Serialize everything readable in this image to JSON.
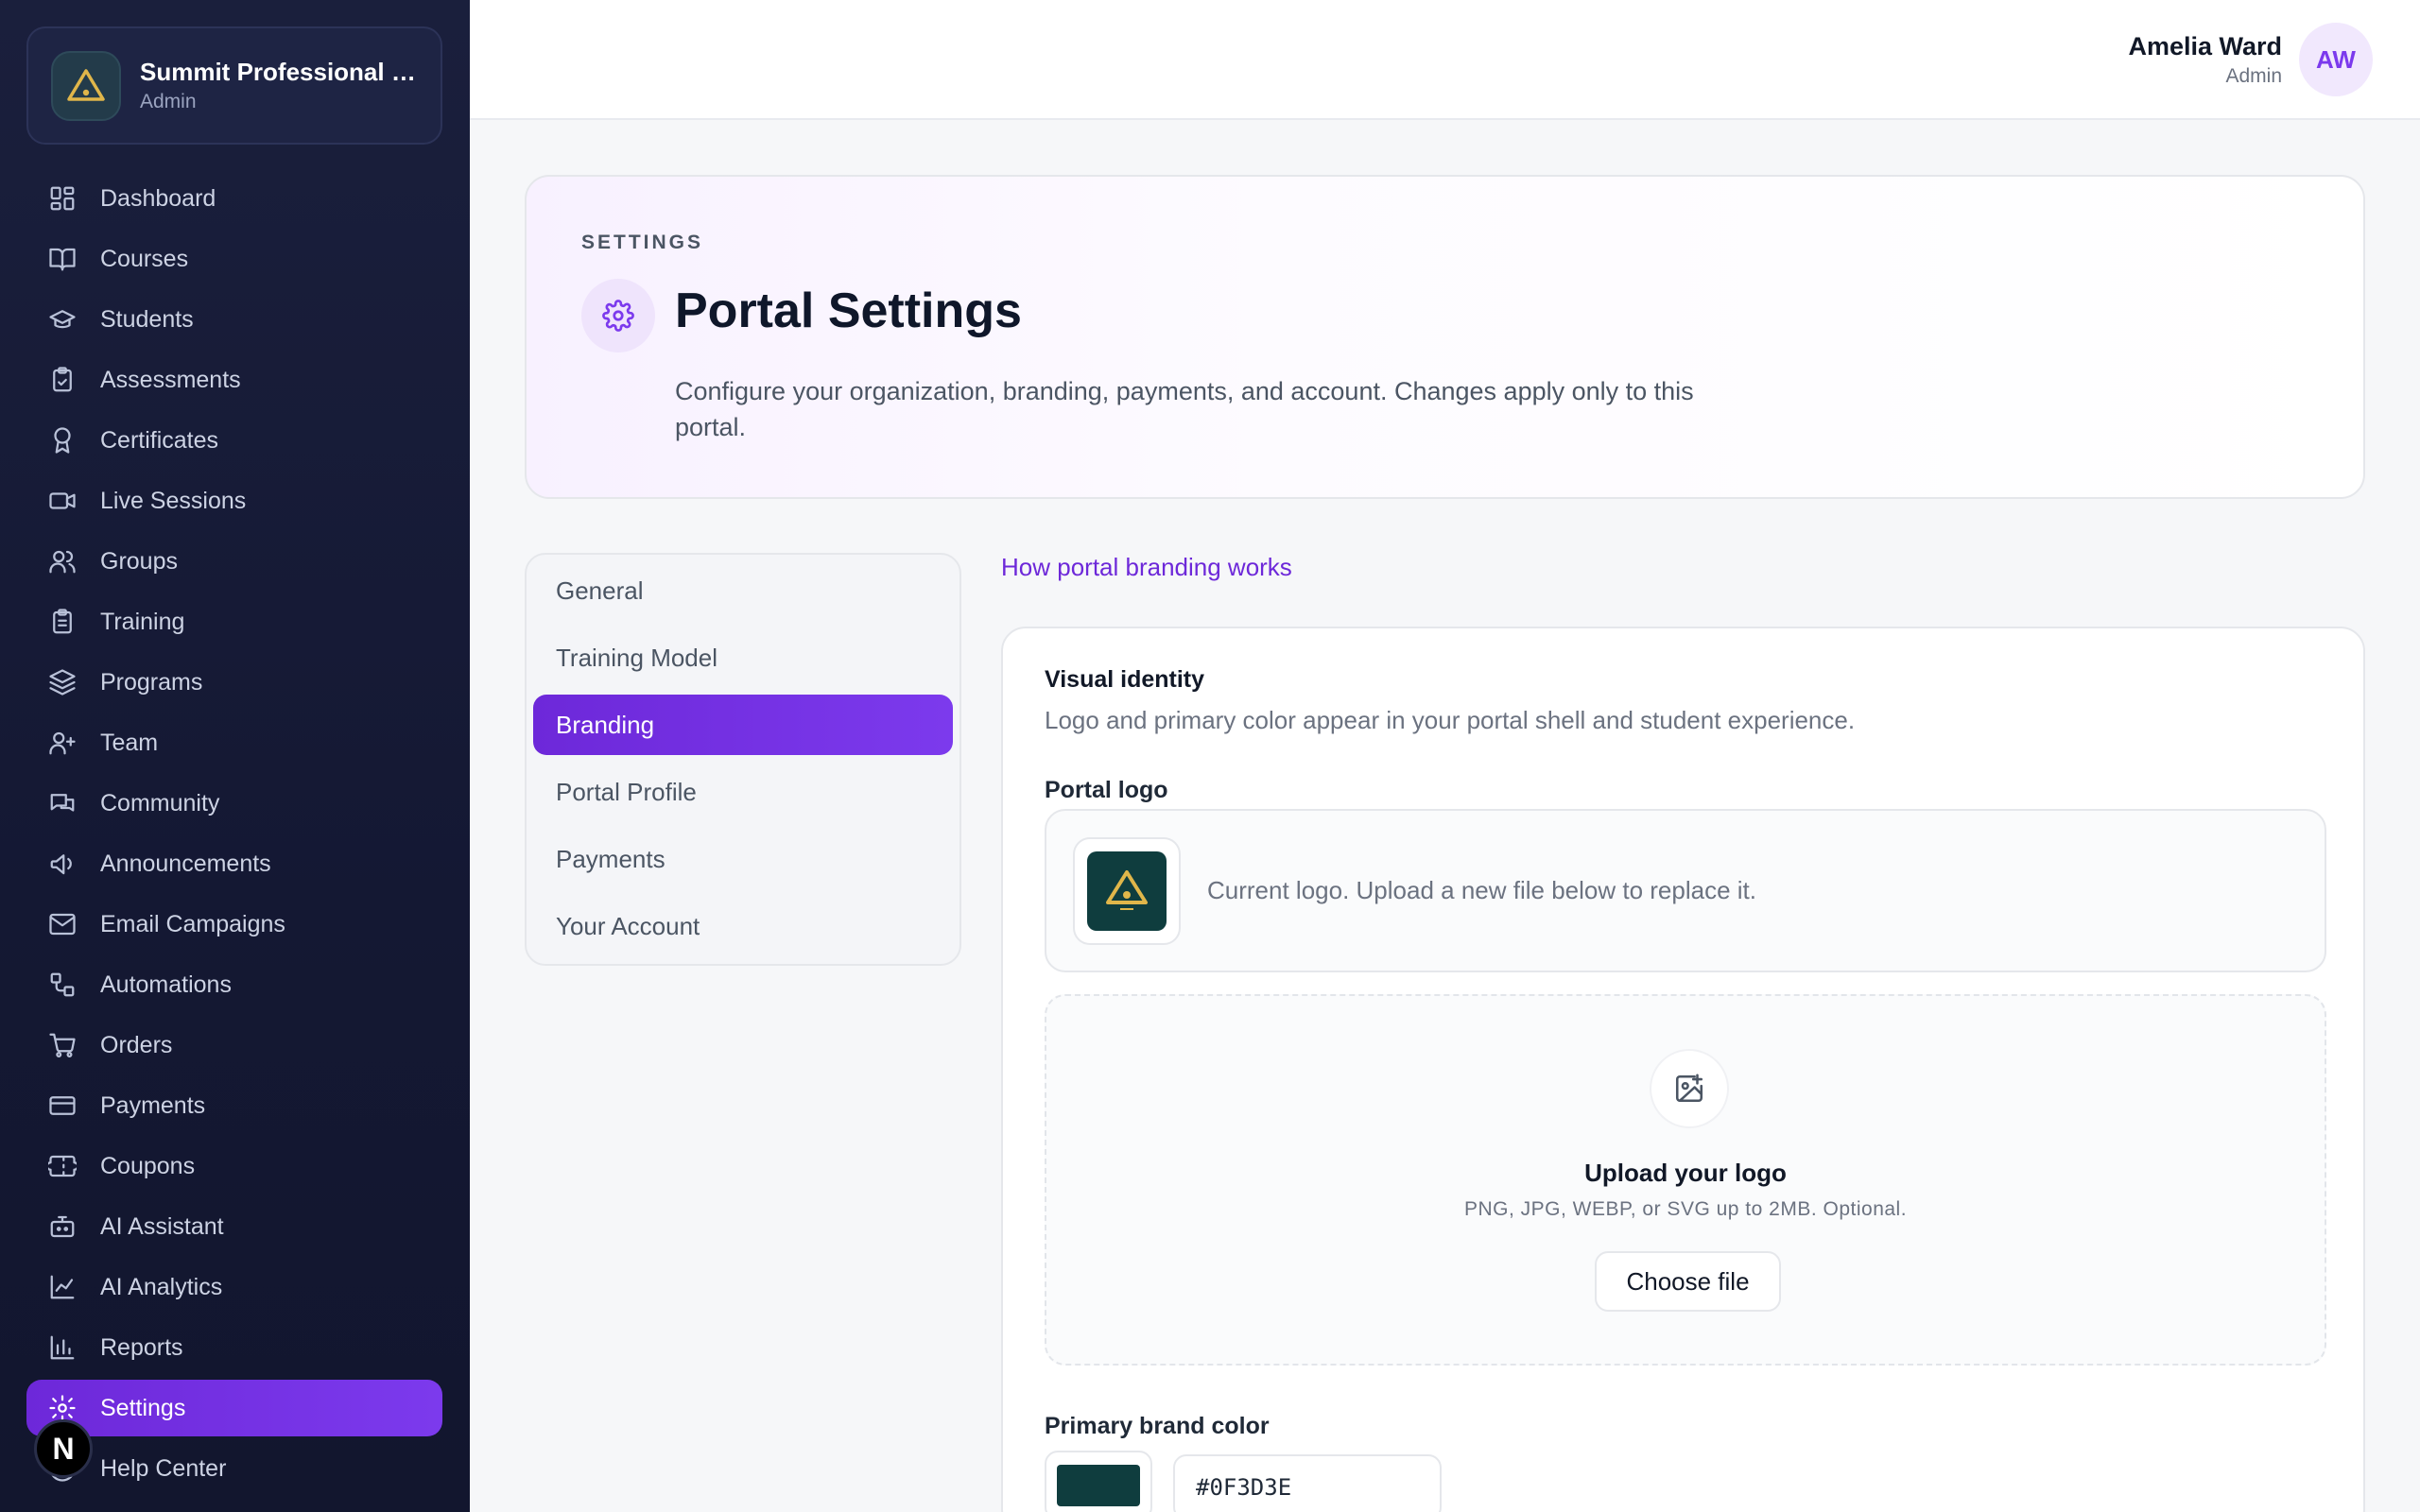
{
  "org": {
    "name": "Summit Professional Group",
    "role": "Admin"
  },
  "nav": [
    {
      "label": "Dashboard",
      "icon": "dashboard-icon"
    },
    {
      "label": "Courses",
      "icon": "book-icon"
    },
    {
      "label": "Students",
      "icon": "graduation-cap-icon"
    },
    {
      "label": "Assessments",
      "icon": "clipboard-check-icon"
    },
    {
      "label": "Certificates",
      "icon": "award-icon"
    },
    {
      "label": "Live Sessions",
      "icon": "video-icon"
    },
    {
      "label": "Groups",
      "icon": "users-icon"
    },
    {
      "label": "Training",
      "icon": "clipboard-list-icon"
    },
    {
      "label": "Programs",
      "icon": "layers-icon"
    },
    {
      "label": "Team",
      "icon": "user-team-icon"
    },
    {
      "label": "Community",
      "icon": "chat-icon"
    },
    {
      "label": "Announcements",
      "icon": "megaphone-icon"
    },
    {
      "label": "Email Campaigns",
      "icon": "mail-icon"
    },
    {
      "label": "Automations",
      "icon": "workflow-icon"
    },
    {
      "label": "Orders",
      "icon": "cart-icon"
    },
    {
      "label": "Payments",
      "icon": "credit-card-icon"
    },
    {
      "label": "Coupons",
      "icon": "ticket-icon"
    },
    {
      "label": "AI Assistant",
      "icon": "bot-icon"
    },
    {
      "label": "AI Analytics",
      "icon": "line-chart-icon"
    },
    {
      "label": "Reports",
      "icon": "bar-chart-icon"
    },
    {
      "label": "Settings",
      "icon": "gear-icon",
      "active": true
    },
    {
      "label": "Help Center",
      "icon": "help-icon"
    }
  ],
  "badge": "N",
  "user": {
    "name": "Amelia Ward",
    "role": "Admin",
    "initials": "AW"
  },
  "hero": {
    "eyebrow": "SETTINGS",
    "title": "Portal Settings",
    "description": "Configure your organization, branding, payments, and account. Changes apply only to this portal."
  },
  "tabs": [
    {
      "label": "General"
    },
    {
      "label": "Training Model"
    },
    {
      "label": "Branding",
      "active": true
    },
    {
      "label": "Portal Profile"
    },
    {
      "label": "Payments"
    },
    {
      "label": "Your Account"
    }
  ],
  "help_link": "How portal branding works",
  "identity": {
    "title": "Visual identity",
    "subtitle": "Logo and primary color appear in your portal shell and student experience.",
    "logo_label": "Portal logo",
    "logo_note": "Current logo. Upload a new file below to replace it.",
    "upload_title": "Upload your logo",
    "upload_hint": "PNG, JPG, WEBP, or SVG up to 2MB. Optional.",
    "choose_file": "Choose file",
    "color_label": "Primary brand color",
    "color_value": "#0F3D3E"
  },
  "colors": {
    "accent": "#7c3aed",
    "sidebar": "#161a35",
    "brand": "#0F3D3E"
  }
}
